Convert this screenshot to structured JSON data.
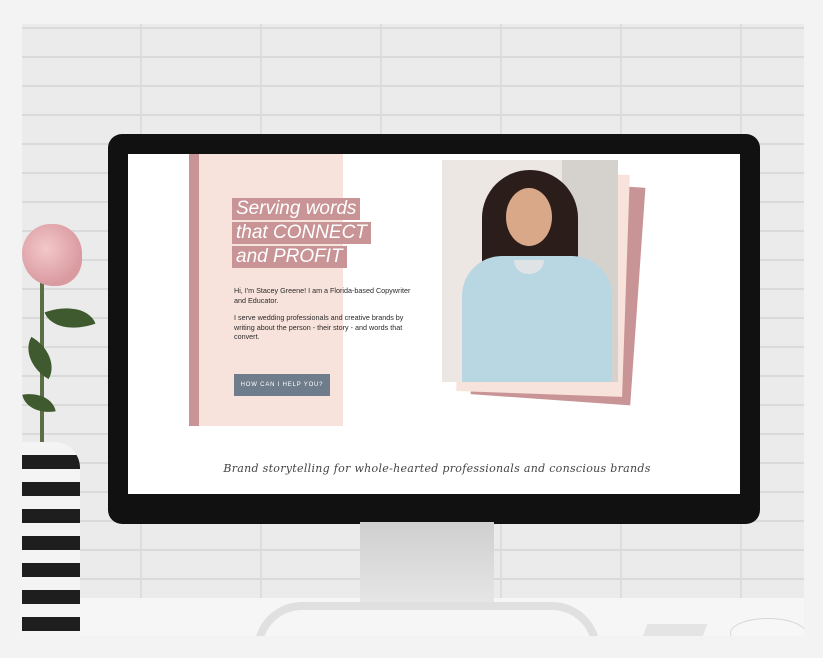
{
  "hero": {
    "headline_lines": [
      "Serving words",
      "that CONNECT",
      "and PROFIT"
    ],
    "intro_paragraph_1": "Hi, I'm Stacey Greene! I am a Florida-based Copywriter and Educator.",
    "intro_paragraph_2": "I serve wedding professionals and creative brands by writing about the person - their story - and words that convert.",
    "cta_label": "HOW CAN I HELP YOU?"
  },
  "tagline": "Brand storytelling for whole-hearted professionals and conscious brands",
  "colors": {
    "accent_rose": "#c89496",
    "blush": "#f8e3dc",
    "cta_slate": "#6f7c8b"
  }
}
